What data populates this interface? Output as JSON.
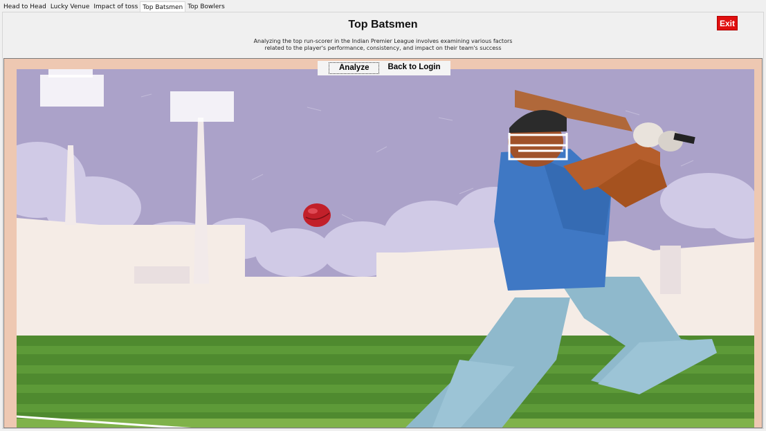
{
  "tabs": [
    {
      "label": "Head to Head",
      "active": false
    },
    {
      "label": "Lucky Venue",
      "active": false
    },
    {
      "label": "Impact of toss",
      "active": false
    },
    {
      "label": "Top Batsmen",
      "active": true
    },
    {
      "label": "Top Bowlers",
      "active": false
    }
  ],
  "header": {
    "title": "Top Batsmen",
    "subtitle_line1": "Analyzing the top run-scorer in the Indian Premier League involves examining various factors",
    "subtitle_line2": "related to the player's performance, consistency, and impact on their team's success",
    "exit_label": "Exit"
  },
  "actions": {
    "analyze_label": "Analyze",
    "back_label": "Back to Login"
  },
  "colors": {
    "exit_button": "#e01010",
    "frame_border": "#eec8b2",
    "sky": "#aba2c9",
    "grass": "#4f8a2f",
    "ball": "#c2202a",
    "jersey": "#3f78c4",
    "trousers": "#8fb9cc"
  },
  "illustration": {
    "subject": "cricket-batsman-illustration"
  }
}
